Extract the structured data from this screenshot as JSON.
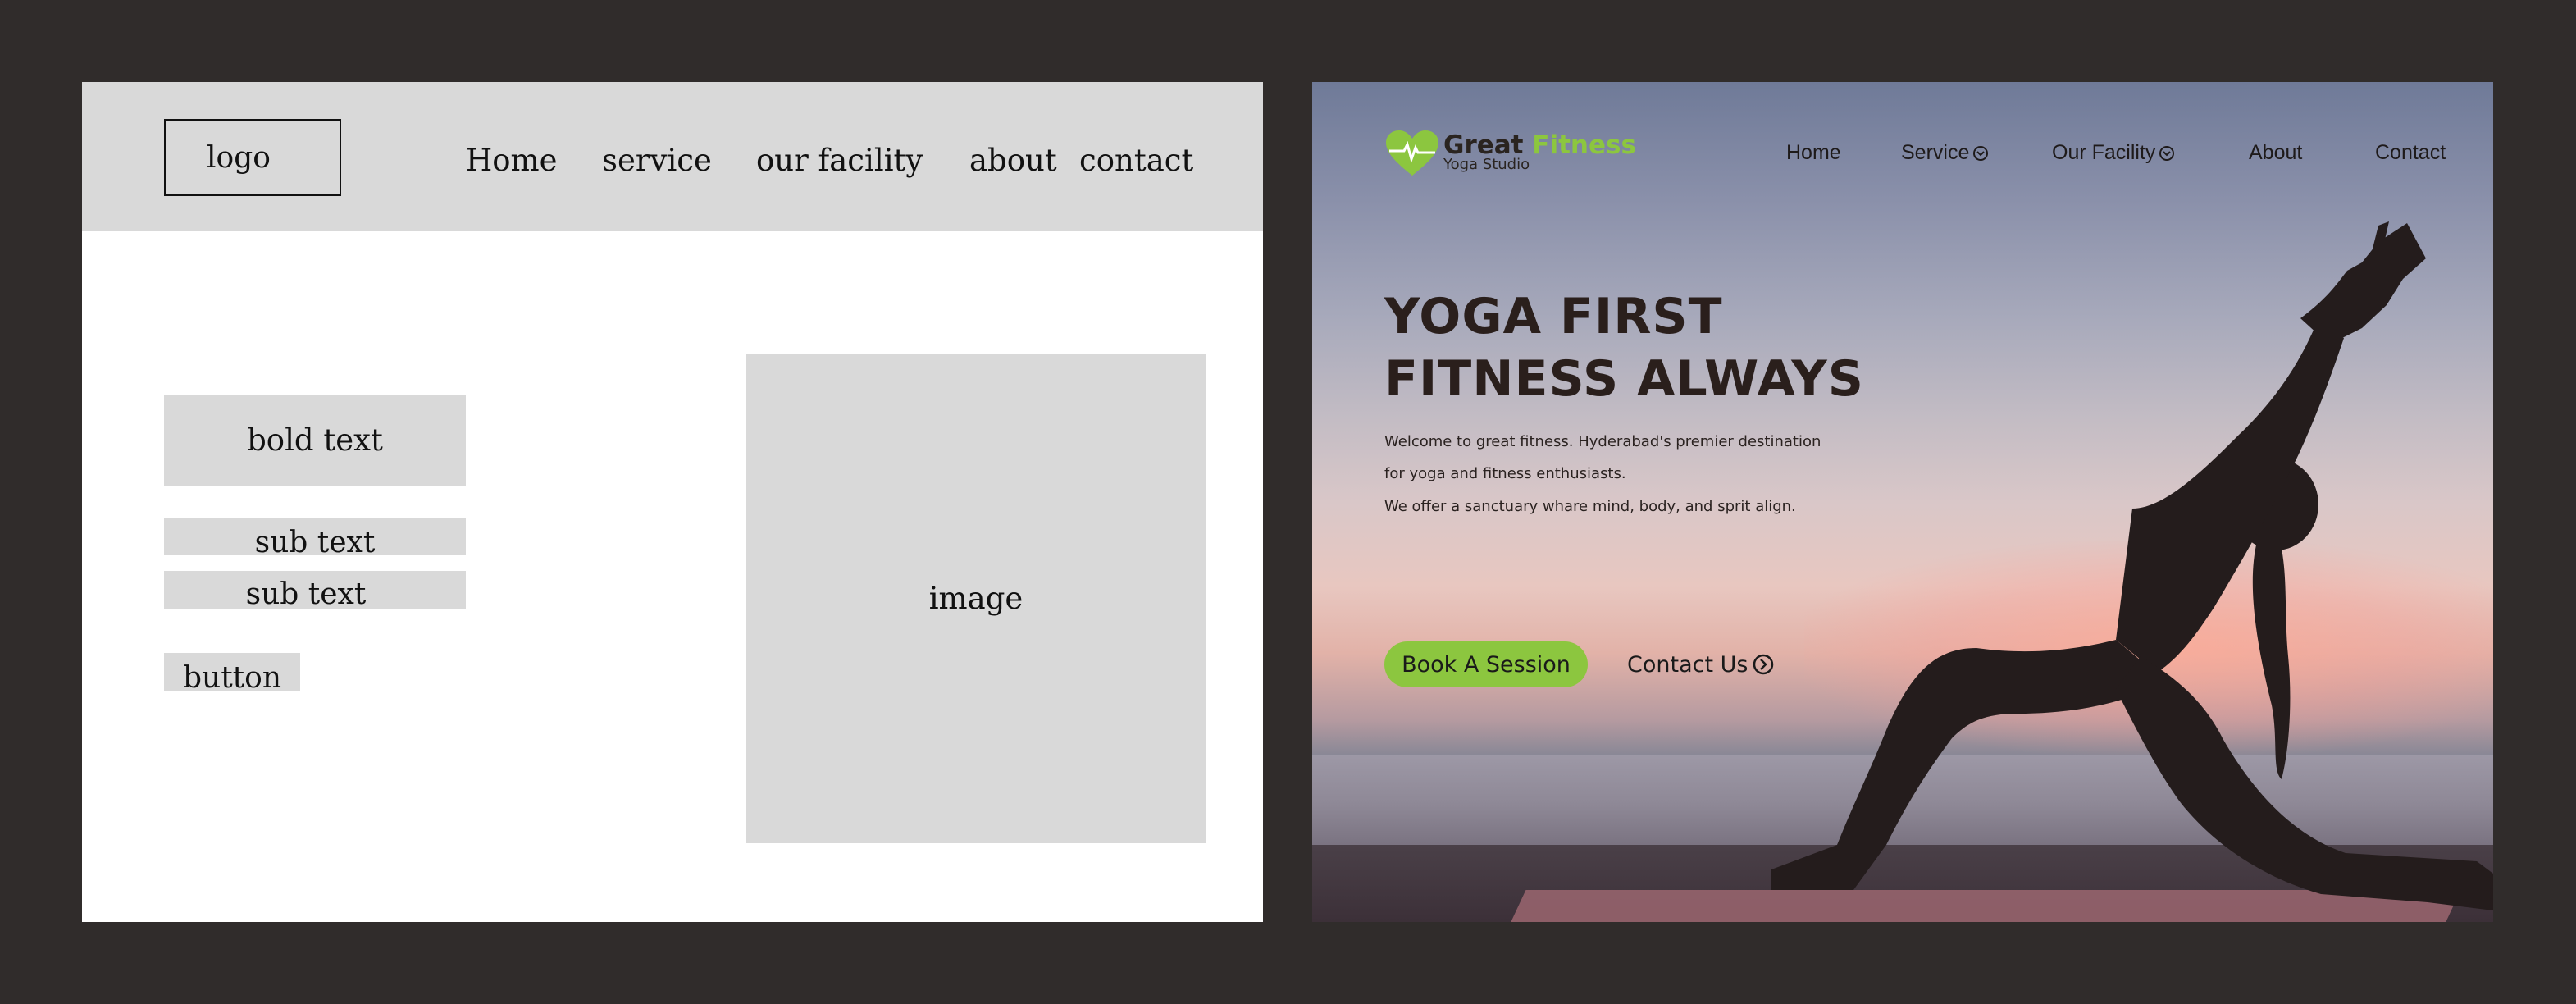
{
  "wireframe": {
    "logo": "logo",
    "nav": [
      "Home",
      "service",
      "our facility",
      "about",
      "contact"
    ],
    "bold_text": "bold text",
    "sub_text_1": "sub text",
    "sub_text_2": "sub text",
    "button": "button",
    "image": "image"
  },
  "design": {
    "brand": {
      "name_part1": "Great",
      "name_part2": "Fitness",
      "tagline": "Yoga Studio"
    },
    "nav": {
      "home": "Home",
      "service": "Service",
      "facility": "Our Facility",
      "about": "About",
      "contact": "Contact"
    },
    "hero": {
      "title_line1": "YOGA FIRST",
      "title_line2": "FITNESS ALWAYS",
      "para_line1": "Welcome to great fitness. Hyderabad's premier destination",
      "para_line2": " for yoga and fitness enthusiasts.",
      "para_line3": "We offer a sanctuary whare mind, body, and sprit align."
    },
    "buttons": {
      "book": "Book A Session",
      "contact": "Contact Us"
    },
    "colors": {
      "accent": "#8cc63f",
      "text_dark": "#2a1f1c",
      "background": "#302c2b",
      "wire_gray": "#d9d9d9"
    },
    "icons": [
      "heart-pulse-icon",
      "chevron-down-circle-icon",
      "arrow-right-circle-icon"
    ]
  }
}
